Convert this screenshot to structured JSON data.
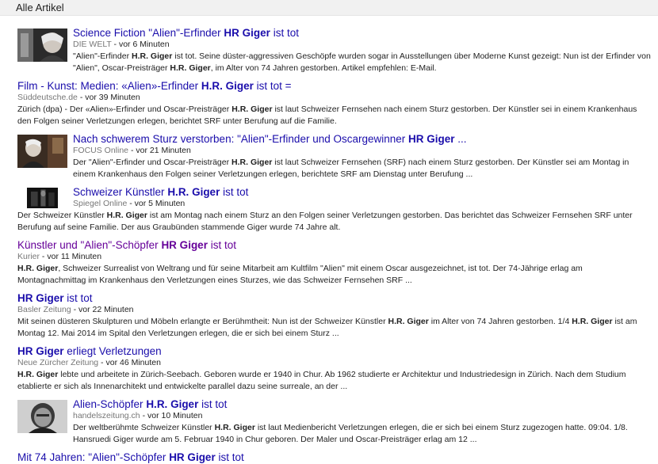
{
  "header": {
    "title": "Alle Artikel"
  },
  "articles": [
    {
      "title_html": "Science Fiction \"Alien\"-Erfinder <b>HR Giger</b> ist tot",
      "source": "DIE WELT",
      "time": "vor 6 Minuten",
      "snippet_html": "\"Alien\"-Erfinder <b>H.R. Giger</b> ist tot. Seine düster-aggressiven Geschöpfe wurden sogar in Ausstellungen über Moderne Kunst gezeigt: Nun ist der Erfinder von \"Alien\", Oscar-Preisträger <b>H.R. Giger</b>, im Alter von 74 Jahren gestorben. Artikel empfehlen: E-Mail.",
      "thumbnail": "photo-giger-portrait"
    },
    {
      "title_html": "Film - Kunst: Medien: «Alien»-Erfinder <b>H.R. Giger</b> ist tot =",
      "source": "Süddeutsche.de",
      "time": "vor 39 Minuten",
      "snippet_html": "Zürich (dpa) - Der «Alien»-Erfinder und Oscar-Preisträger <b>H.R. Giger</b> ist laut Schweizer Fernsehen nach einem Sturz gestorben. Der Künstler sei in einem Krankenhaus den Folgen seiner Verletzungen erlegen, berichtet SRF unter Berufung auf die Familie."
    },
    {
      "title_html": "Nach schwerem Sturz verstorben: \"Alien\"-Erfinder und Oscargewinner <b>HR Giger</b> ...",
      "source": "FOCUS Online",
      "time": "vor 21 Minuten",
      "snippet_html": "Der \"Alien\"-Erfinder und Oscar-Preisträger <b>H.R. Giger</b> ist laut Schweizer Fernsehen (SRF) nach einem Sturz gestorben. Der Künstler sei am Montag in einem Krankenhaus den Folgen seiner Verletzungen erlegen, berichtete SRF am Dienstag unter Berufung ...",
      "thumbnail": "photo-giger-gallery"
    },
    {
      "title_html": "Schweizer Künstler <b>H.R. Giger</b> ist tot",
      "source": "Spiegel Online",
      "time": "vor 5 Minuten",
      "snippet_html": "Der Schweizer Künstler <b>H.R. Giger</b> ist am Montag nach einem Sturz an den Folgen seiner Verletzungen gestorben. Das berichtet das Schweizer Fernsehen SRF unter Berufung auf seine Familie. Der aus Graubünden stammende Giger wurde 74 Jahre alt.",
      "thumbnail": "photo-dark-film"
    },
    {
      "title_html": "Künstler und \"Alien\"-Schöpfer <b>HR Giger</b> ist tot",
      "visited": true,
      "source": "Kurier",
      "time": "vor 11 Minuten",
      "snippet_html": "<b>H.R. Giger</b>, Schweizer Surrealist von Weltrang und für seine Mitarbeit am Kultfilm \"Alien\" mit einem Oscar ausgezeichnet, ist tot. Der 74-Jährige erlag am Montagnachmittag im Krankenhaus den Verletzungen eines Sturzes, wie das Schweizer Fernsehen SRF ..."
    },
    {
      "title_html": "<b>HR Giger</b> ist tot",
      "source": "Basler Zeitung",
      "time": "vor 22 Minuten",
      "snippet_html": "Mit seinen düsteren Skulpturen und Möbeln erlangte er Berühmtheit: Nun ist der Schweizer Künstler <b>H.R. Giger</b> im Alter von 74 Jahren gestorben. 1/4 <b>H.R. Giger</b> ist am Montag 12. Mai 2014 im Spital den Verletzungen erlegen, die er sich bei einem Sturz ..."
    },
    {
      "title_html": "<b>HR Giger</b> erliegt Verletzungen",
      "source": "Neue Zürcher Zeitung",
      "time": "vor 46 Minuten",
      "snippet_html": "<b>H.R. Giger</b> lebte und arbeitete in Zürich-Seebach. Geboren wurde er 1940 in Chur. Ab 1962 studierte er Architektur und Industriedesign in Zürich. Nach dem Studium etablierte er sich als Innenarchitekt und entwickelte parallel dazu seine surreale, an der ..."
    },
    {
      "title_html": "Alien-Schöpfer <b>H.R. Giger</b> ist tot",
      "source": "handelszeitung.ch",
      "time": "vor 10 Minuten",
      "snippet_html": "Der weltberühmte Schweizer Künstler <b>H.R. Giger</b> ist laut Medienbericht Verletzungen erlegen, die er sich bei einem Sturz zugezogen hatte. 09:04. 1/8. Hansruedi Giger wurde am 5. Februar 1940 in Chur geboren. Der Maler und Oscar-Preisträger erlag am 12 ...",
      "thumbnail": "photo-giger-bw"
    },
    {
      "title_html": "Mit 74 Jahren: \"Alien\"-Schöpfer <b>HR Giger</b> ist tot"
    }
  ]
}
